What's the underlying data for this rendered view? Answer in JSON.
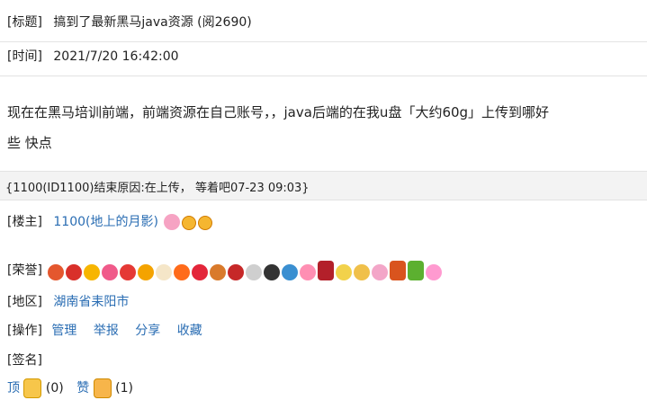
{
  "post": {
    "title_label": "[标题]",
    "title": "搞到了最新黑马java资源 (阅2690)",
    "time_label": "[时间]",
    "time": "2021/7/20 16:42:00",
    "content_line1": "现在在黑马培训前端，前端资源在自己账号，，java后端的在我u盘「大约60g」上传到哪好",
    "content_line2": "些 快点"
  },
  "end_notice": "{1100(ID1100)结束原因:在上传， 等着吧07-23 09:03}",
  "author": {
    "label": "[楼主]",
    "name": "1100(地上的月影)",
    "badge_icons": [
      "girl-avatar-icon",
      "crown-icon",
      "crown-icon"
    ]
  },
  "honors": {
    "label": "[荣誉]",
    "icons": [
      "gift-box-icon",
      "red-ribbon-icon",
      "sun-icon",
      "fortune-box-icon",
      "strawberry-icon",
      "yuan-coin-icon",
      "chicken-icon",
      "fire-icon",
      "heart-icon",
      "mooncake-icon",
      "santa-icon",
      "panda-icon",
      "black-cat-icon",
      "pinwheel-icon",
      "pink-hearts-icon",
      "red-gift-icon",
      "star-moon-icon",
      "chick-egg-icon",
      "bow-bunny-icon",
      "medal-icon",
      "dragon-boat-icon",
      "pink-bow-icon"
    ]
  },
  "region": {
    "label": "[地区]",
    "value": "湖南省耒阳市"
  },
  "operations": {
    "label": "[操作]",
    "manage": "管理",
    "report": "举报",
    "share": "分享",
    "favorite": "收藏"
  },
  "signature": {
    "label": "[签名]"
  },
  "votes": {
    "up_label": "顶",
    "up_count": "(0)",
    "like_label": "赞",
    "like_count": "(1)"
  },
  "colors": {
    "link": "#2a6db3",
    "bar": "#f3f3f3"
  }
}
